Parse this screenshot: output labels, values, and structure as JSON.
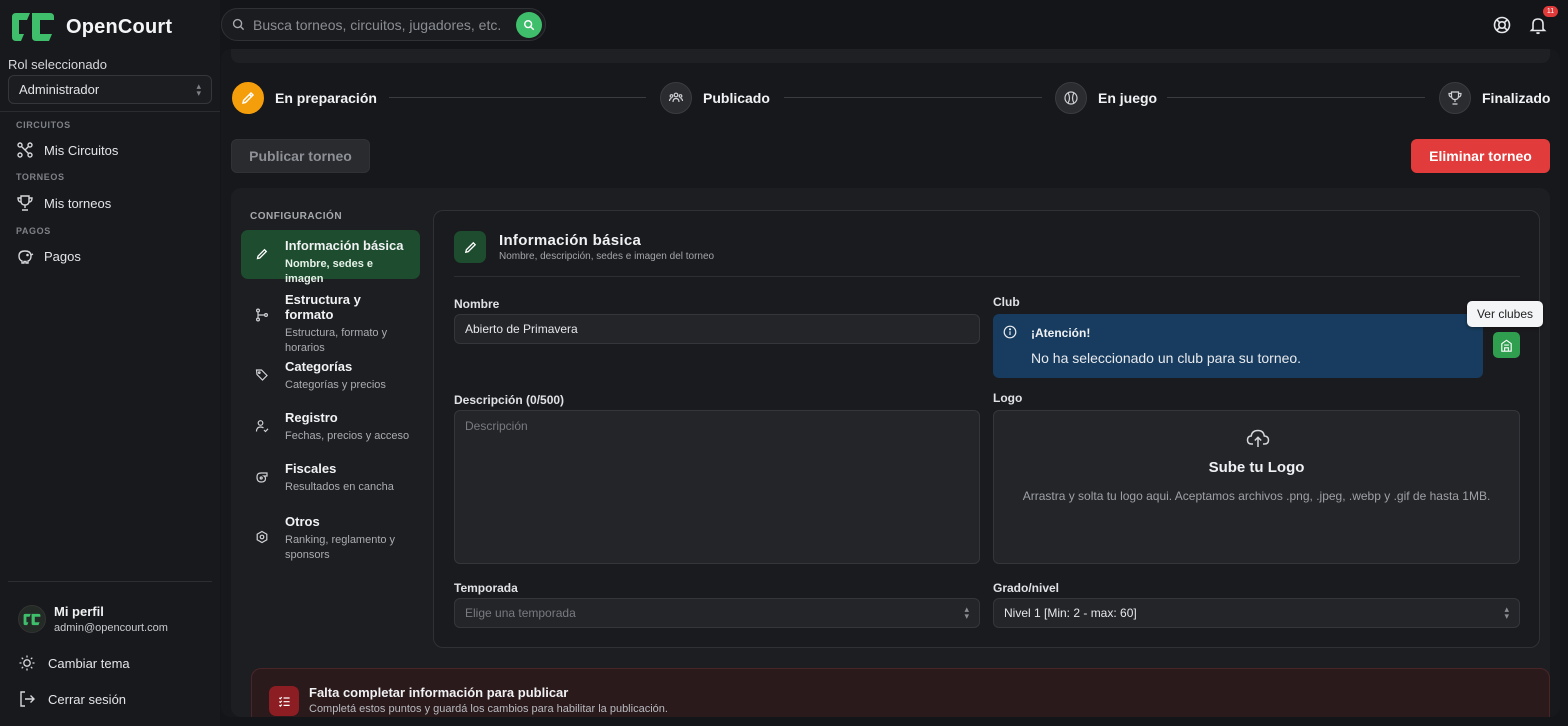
{
  "app": {
    "name": "OpenCourt"
  },
  "search": {
    "placeholder": "Busca torneos, circuitos, jugadores, etc."
  },
  "topbar": {
    "notification_count": "11"
  },
  "sidebar": {
    "role_label": "Rol seleccionado",
    "role_value": "Administrador",
    "sections": [
      {
        "title": "CIRCUITOS",
        "item": "Mis Circuitos",
        "icon": "circuit-icon"
      },
      {
        "title": "TORNEOS",
        "item": "Mis torneos",
        "icon": "trophy-icon"
      },
      {
        "title": "PAGOS",
        "item": "Pagos",
        "icon": "piggy-bank-icon"
      }
    ],
    "profile": {
      "name": "Mi perfil",
      "email": "admin@opencourt.com"
    },
    "actions": {
      "theme": "Cambiar tema",
      "logout": "Cerrar sesión"
    }
  },
  "stepper": {
    "steps": [
      {
        "label": "En preparación",
        "state": "active",
        "icon": "pencil-icon"
      },
      {
        "label": "Publicado",
        "state": "pending",
        "icon": "people-icon"
      },
      {
        "label": "En juego",
        "state": "pending",
        "icon": "ball-icon"
      },
      {
        "label": "Finalizado",
        "state": "pending",
        "icon": "trophy-icon"
      }
    ]
  },
  "buttons": {
    "publish": "Publicar torneo",
    "delete": "Eliminar torneo"
  },
  "config": {
    "title": "CONFIGURACIÓN",
    "menu": [
      {
        "title": "Información básica",
        "sub": "Nombre, sedes e imagen",
        "active": true
      },
      {
        "title": "Estructura y formato",
        "sub": "Estructura, formato y horarios",
        "active": false
      },
      {
        "title": "Categorías",
        "sub": "Categorías y precios",
        "active": false
      },
      {
        "title": "Registro",
        "sub": "Fechas, precios y acceso",
        "active": false
      },
      {
        "title": "Fiscales",
        "sub": "Resultados en cancha",
        "active": false
      },
      {
        "title": "Otros",
        "sub": "Ranking, reglamento y sponsors",
        "active": false
      }
    ]
  },
  "form": {
    "title": "Información básica",
    "subtitle": "Nombre, descripción, sedes e imagen del torneo",
    "name_label": "Nombre",
    "name_value": "Abierto de Primavera",
    "club_label": "Club",
    "club_alert_title": "¡Atención!",
    "club_alert_text": "No ha seleccionado un club para su torneo.",
    "clubs_tooltip": "Ver clubes",
    "description_label": "Descripción (0/500)",
    "description_placeholder": "Descripción",
    "logo_label": "Logo",
    "logo_title": "Sube tu Logo",
    "logo_text": "Arrastra y solta tu logo aqui. Aceptamos archivos .png, .jpeg, .webp y .gif de hasta 1MB.",
    "season_label": "Temporada",
    "season_placeholder": "Elige una temporada",
    "level_label": "Grado/nivel",
    "level_value": "Nivel 1 [Min: 2 - max: 60]"
  },
  "missing": {
    "title": "Falta completar información para publicar",
    "text": "Completá estos puntos y guardá los cambios para habilitar la publicación."
  },
  "colors": {
    "accent_green": "#3fbf6c",
    "active_step": "#f59e0b",
    "danger": "#e23b3b",
    "alert_blue": "#173c5f"
  }
}
